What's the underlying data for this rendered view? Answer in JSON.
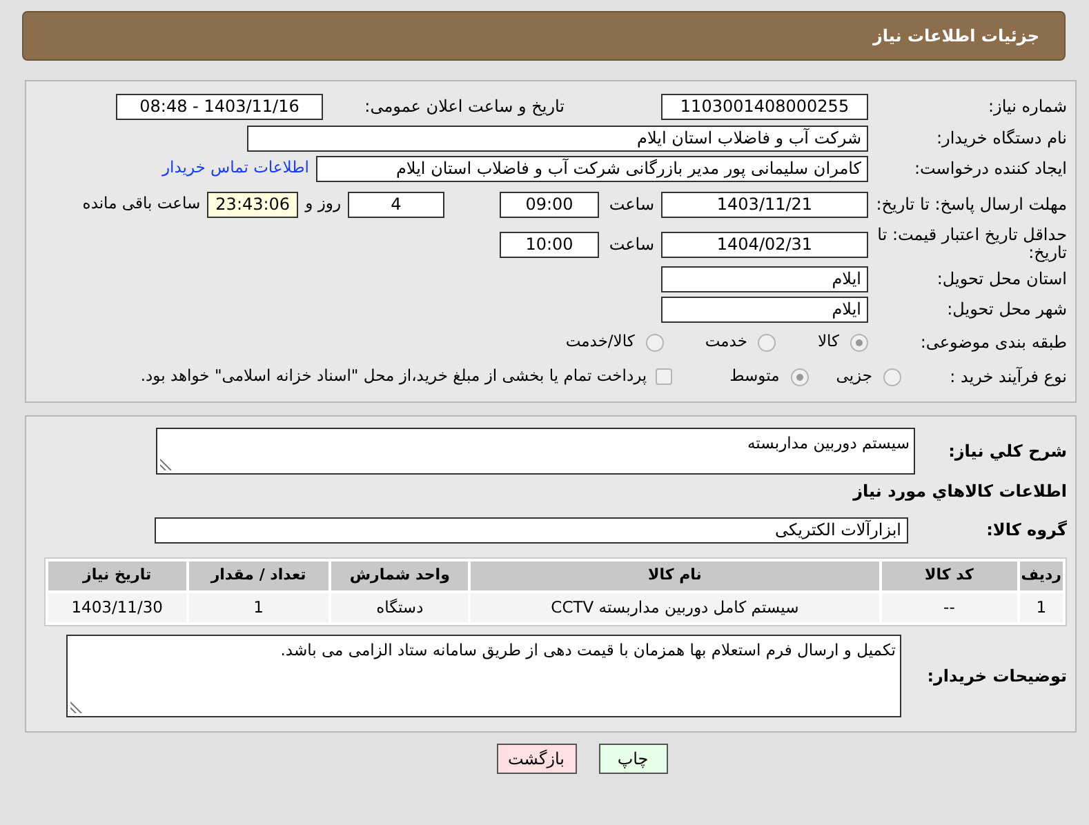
{
  "header": {
    "title": "جزئیات اطلاعات نیاز"
  },
  "need_number": {
    "label": "شماره نیاز:",
    "value": "1103001408000255"
  },
  "announce": {
    "label": "تاریخ و ساعت اعلان عمومی:",
    "value": "1403/11/16 - 08:48"
  },
  "buyer_org": {
    "label": "نام دستگاه خریدار:",
    "value": "شرکت آب و فاضلاب استان ایلام"
  },
  "requester": {
    "label": "ایجاد کننده درخواست:",
    "value": "کامران سلیمانی پور مدیر بازرگانی شرکت آب و فاضلاب استان ایلام",
    "link": "اطلاعات تماس خریدار"
  },
  "reply_deadline": {
    "label": "مهلت ارسال پاسخ: تا تاریخ:",
    "date": "1403/11/21",
    "time_label": "ساعت",
    "time": "09:00",
    "days": "4",
    "days_label": "روز و",
    "remaining": "23:43:06",
    "remaining_label": "ساعت باقی مانده"
  },
  "price_validity": {
    "label": "حداقل تاریخ اعتبار قیمت: تا تاریخ:",
    "date": "1404/02/31",
    "time_label": "ساعت",
    "time": "10:00"
  },
  "province": {
    "label": "استان محل تحویل:",
    "value": "ایلام"
  },
  "city": {
    "label": "شهر محل تحویل:",
    "value": "ایلام"
  },
  "category": {
    "label": "طبقه بندی موضوعی:",
    "options": [
      {
        "label": "کالا",
        "selected": true
      },
      {
        "label": "خدمت",
        "selected": false
      },
      {
        "label": "کالا/خدمت",
        "selected": false
      }
    ]
  },
  "process": {
    "label": "نوع فرآیند خرید :",
    "options": [
      {
        "label": "جزیی",
        "selected": false
      },
      {
        "label": "متوسط",
        "selected": true
      }
    ],
    "treasury": {
      "label": "پرداخت تمام یا بخشی از مبلغ خرید،از محل \"اسناد خزانه اسلامی\" خواهد بود.",
      "checked": false
    }
  },
  "description": {
    "label": "شرح کلي نياز:",
    "value": "سیستم دوربین مداربسته"
  },
  "goods_title": "اطلاعات کالاهاي مورد نياز",
  "goods_group": {
    "label": "گروه کالا:",
    "value": "ابزارآلات الکتریکی"
  },
  "table": {
    "columns": [
      "ردیف",
      "کد کالا",
      "نام کالا",
      "واحد شمارش",
      "تعداد / مقدار",
      "تاریخ نیاز"
    ],
    "rows": [
      [
        "1",
        "--",
        "سیستم کامل دوربین مداربسته CCTV",
        "دستگاه",
        "1",
        "1403/11/30"
      ]
    ]
  },
  "buyer_notes": {
    "label": "توضیحات خریدار:",
    "value": "تکمیل و ارسال فرم استعلام بها همزمان با قیمت دهی از طریق سامانه ستاد الزامی می باشد."
  },
  "buttons": [
    {
      "label": "چاپ",
      "kind": "print"
    },
    {
      "label": "بازگشت",
      "kind": "back"
    }
  ]
}
